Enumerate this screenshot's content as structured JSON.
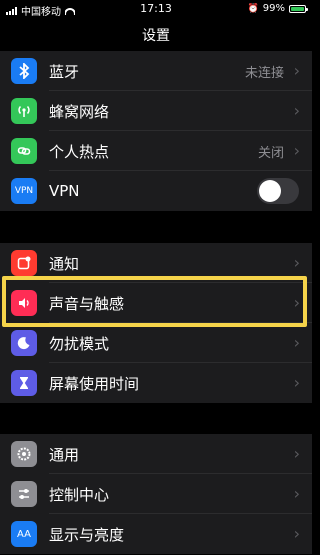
{
  "status": {
    "carrier": "中国移动",
    "time": "17:13",
    "battery_percent": "99%",
    "battery_level": 0.99
  },
  "nav": {
    "title": "设置"
  },
  "groups": [
    {
      "items": [
        {
          "label": "蓝牙",
          "value": "未连接",
          "icon": "bluetooth-icon",
          "color": "#1a7cf4"
        },
        {
          "label": "蜂窝网络",
          "value": "",
          "icon": "cellular-icon",
          "color": "#34c759"
        },
        {
          "label": "个人热点",
          "value": "关闭",
          "icon": "hotspot-icon",
          "color": "#34c759"
        },
        {
          "label": "VPN",
          "value": "",
          "icon": "vpn-icon",
          "color": "#1a7cf4",
          "toggle": false
        }
      ]
    },
    {
      "items": [
        {
          "label": "通知",
          "icon": "notifications-icon",
          "color": "#ff3b30"
        },
        {
          "label": "声音与触感",
          "icon": "sounds-icon",
          "color": "#ff2d55",
          "highlighted": true
        },
        {
          "label": "勿扰模式",
          "icon": "do-not-disturb-icon",
          "color": "#5e5ce6"
        },
        {
          "label": "屏幕使用时间",
          "icon": "screen-time-icon",
          "color": "#5e5ce6"
        }
      ]
    },
    {
      "items": [
        {
          "label": "通用",
          "icon": "general-icon",
          "color": "#8e8e93"
        },
        {
          "label": "控制中心",
          "icon": "control-center-icon",
          "color": "#8e8e93"
        },
        {
          "label": "显示与亮度",
          "icon": "display-brightness-icon",
          "color": "#1a7cf4"
        }
      ]
    }
  ],
  "icons": {
    "vpn_text": "VPN",
    "display_text": "AA"
  },
  "highlight_color": "#f5d34a"
}
